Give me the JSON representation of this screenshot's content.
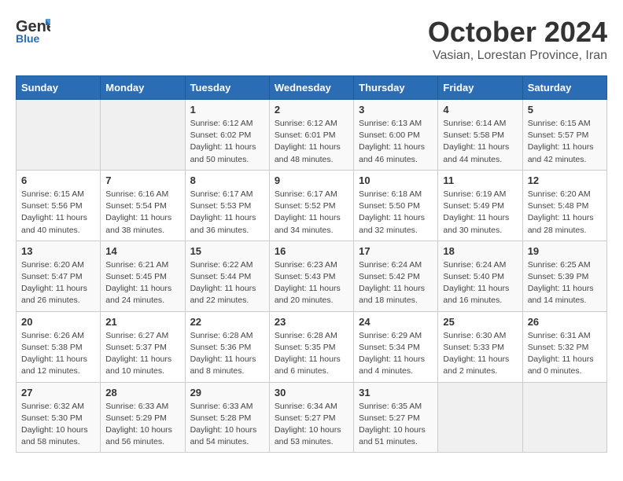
{
  "header": {
    "logo_general": "General",
    "logo_blue": "Blue",
    "month": "October 2024",
    "location": "Vasian, Lorestan Province, Iran"
  },
  "weekdays": [
    "Sunday",
    "Monday",
    "Tuesday",
    "Wednesday",
    "Thursday",
    "Friday",
    "Saturday"
  ],
  "weeks": [
    [
      {
        "day": "",
        "empty": true
      },
      {
        "day": "",
        "empty": true
      },
      {
        "day": "1",
        "sunrise": "6:12 AM",
        "sunset": "6:02 PM",
        "daylight": "11 hours and 50 minutes."
      },
      {
        "day": "2",
        "sunrise": "6:12 AM",
        "sunset": "6:01 PM",
        "daylight": "11 hours and 48 minutes."
      },
      {
        "day": "3",
        "sunrise": "6:13 AM",
        "sunset": "6:00 PM",
        "daylight": "11 hours and 46 minutes."
      },
      {
        "day": "4",
        "sunrise": "6:14 AM",
        "sunset": "5:58 PM",
        "daylight": "11 hours and 44 minutes."
      },
      {
        "day": "5",
        "sunrise": "6:15 AM",
        "sunset": "5:57 PM",
        "daylight": "11 hours and 42 minutes."
      }
    ],
    [
      {
        "day": "6",
        "sunrise": "6:15 AM",
        "sunset": "5:56 PM",
        "daylight": "11 hours and 40 minutes."
      },
      {
        "day": "7",
        "sunrise": "6:16 AM",
        "sunset": "5:54 PM",
        "daylight": "11 hours and 38 minutes."
      },
      {
        "day": "8",
        "sunrise": "6:17 AM",
        "sunset": "5:53 PM",
        "daylight": "11 hours and 36 minutes."
      },
      {
        "day": "9",
        "sunrise": "6:17 AM",
        "sunset": "5:52 PM",
        "daylight": "11 hours and 34 minutes."
      },
      {
        "day": "10",
        "sunrise": "6:18 AM",
        "sunset": "5:50 PM",
        "daylight": "11 hours and 32 minutes."
      },
      {
        "day": "11",
        "sunrise": "6:19 AM",
        "sunset": "5:49 PM",
        "daylight": "11 hours and 30 minutes."
      },
      {
        "day": "12",
        "sunrise": "6:20 AM",
        "sunset": "5:48 PM",
        "daylight": "11 hours and 28 minutes."
      }
    ],
    [
      {
        "day": "13",
        "sunrise": "6:20 AM",
        "sunset": "5:47 PM",
        "daylight": "11 hours and 26 minutes."
      },
      {
        "day": "14",
        "sunrise": "6:21 AM",
        "sunset": "5:45 PM",
        "daylight": "11 hours and 24 minutes."
      },
      {
        "day": "15",
        "sunrise": "6:22 AM",
        "sunset": "5:44 PM",
        "daylight": "11 hours and 22 minutes."
      },
      {
        "day": "16",
        "sunrise": "6:23 AM",
        "sunset": "5:43 PM",
        "daylight": "11 hours and 20 minutes."
      },
      {
        "day": "17",
        "sunrise": "6:24 AM",
        "sunset": "5:42 PM",
        "daylight": "11 hours and 18 minutes."
      },
      {
        "day": "18",
        "sunrise": "6:24 AM",
        "sunset": "5:40 PM",
        "daylight": "11 hours and 16 minutes."
      },
      {
        "day": "19",
        "sunrise": "6:25 AM",
        "sunset": "5:39 PM",
        "daylight": "11 hours and 14 minutes."
      }
    ],
    [
      {
        "day": "20",
        "sunrise": "6:26 AM",
        "sunset": "5:38 PM",
        "daylight": "11 hours and 12 minutes."
      },
      {
        "day": "21",
        "sunrise": "6:27 AM",
        "sunset": "5:37 PM",
        "daylight": "11 hours and 10 minutes."
      },
      {
        "day": "22",
        "sunrise": "6:28 AM",
        "sunset": "5:36 PM",
        "daylight": "11 hours and 8 minutes."
      },
      {
        "day": "23",
        "sunrise": "6:28 AM",
        "sunset": "5:35 PM",
        "daylight": "11 hours and 6 minutes."
      },
      {
        "day": "24",
        "sunrise": "6:29 AM",
        "sunset": "5:34 PM",
        "daylight": "11 hours and 4 minutes."
      },
      {
        "day": "25",
        "sunrise": "6:30 AM",
        "sunset": "5:33 PM",
        "daylight": "11 hours and 2 minutes."
      },
      {
        "day": "26",
        "sunrise": "6:31 AM",
        "sunset": "5:32 PM",
        "daylight": "11 hours and 0 minutes."
      }
    ],
    [
      {
        "day": "27",
        "sunrise": "6:32 AM",
        "sunset": "5:30 PM",
        "daylight": "10 hours and 58 minutes."
      },
      {
        "day": "28",
        "sunrise": "6:33 AM",
        "sunset": "5:29 PM",
        "daylight": "10 hours and 56 minutes."
      },
      {
        "day": "29",
        "sunrise": "6:33 AM",
        "sunset": "5:28 PM",
        "daylight": "10 hours and 54 minutes."
      },
      {
        "day": "30",
        "sunrise": "6:34 AM",
        "sunset": "5:27 PM",
        "daylight": "10 hours and 53 minutes."
      },
      {
        "day": "31",
        "sunrise": "6:35 AM",
        "sunset": "5:27 PM",
        "daylight": "10 hours and 51 minutes."
      },
      {
        "day": "",
        "empty": true
      },
      {
        "day": "",
        "empty": true
      }
    ]
  ]
}
